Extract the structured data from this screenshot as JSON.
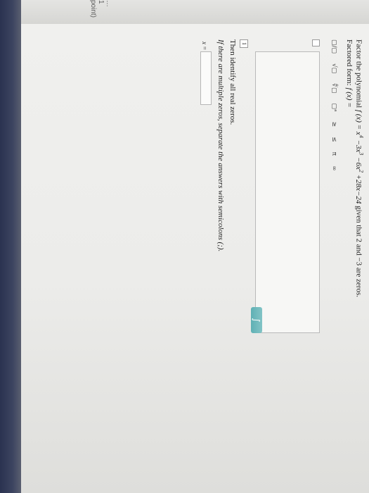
{
  "header_fragment": "… 1 point)",
  "problem": {
    "prefix": "Factor the polynomial",
    "function_name": "f (x) =",
    "expression_terms": [
      "x",
      "4",
      "−3x",
      "3",
      "−6x",
      "2",
      "+28x−24"
    ],
    "suffix": "given that 2 and −3 are zeros."
  },
  "factored": {
    "label": "Factored form:",
    "function_label": "f (x) ="
  },
  "toolbar": {
    "items": [
      "▢/▢",
      "√▢",
      "∜▢",
      "▢ᵃ",
      "≥",
      "≤",
      "π",
      "∞"
    ]
  },
  "step": {
    "number": "1",
    "instruction": "Then identify all real zeros.",
    "hint": "If there are multiple zeros, separate the answers with semicolons (;).",
    "zero_label": "x ="
  },
  "keyboard_button_label": "∫"
}
